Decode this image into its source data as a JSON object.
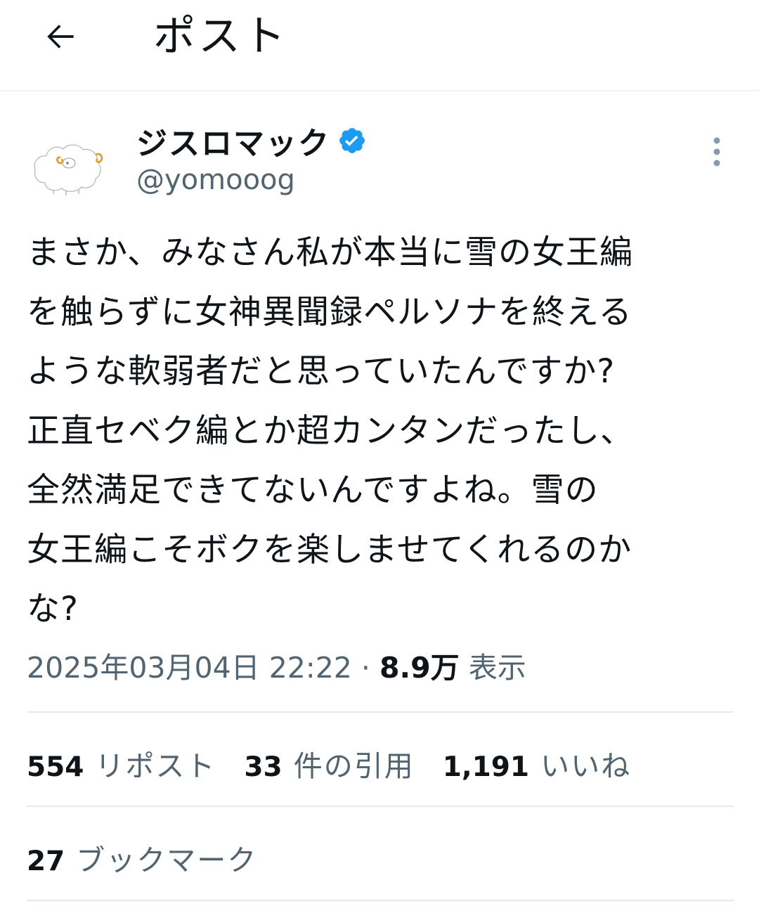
{
  "header": {
    "title": "ポスト",
    "back_icon": "arrow-left-icon"
  },
  "author": {
    "display_name": "ジスロマック",
    "handle": "@yomooog",
    "verified": true,
    "verified_color": "#1d9bf0",
    "avatar": "sheep-drawing-avatar"
  },
  "more_icon": "vertical-ellipsis-icon",
  "tweet": {
    "text": "まさか、みなさん私が本当に雪の女王編\nを触らずに女神異聞録ペルソナを終える\nような軟弱者だと思っていたんですか?\n正直セベク編とか超カンタンだったし、\n全然満足できてないんですよね。雪の\n女王編こそボクを楽しませてくれるのか\nな?",
    "timestamp": "2025年03月04日 22:22",
    "separator": "·",
    "views_count": "8.9万",
    "views_label": "表示"
  },
  "stats": {
    "reposts_count": "554",
    "reposts_label": "リポスト",
    "quotes_count": "33",
    "quotes_label": "件の引用",
    "likes_count": "1,191",
    "likes_label": "いいね",
    "bookmarks_count": "27",
    "bookmarks_label": "ブックマーク"
  },
  "colors": {
    "text_primary": "#0f1419",
    "text_secondary": "#536471",
    "divider": "#e6e9ea",
    "accent": "#1d9bf0"
  }
}
